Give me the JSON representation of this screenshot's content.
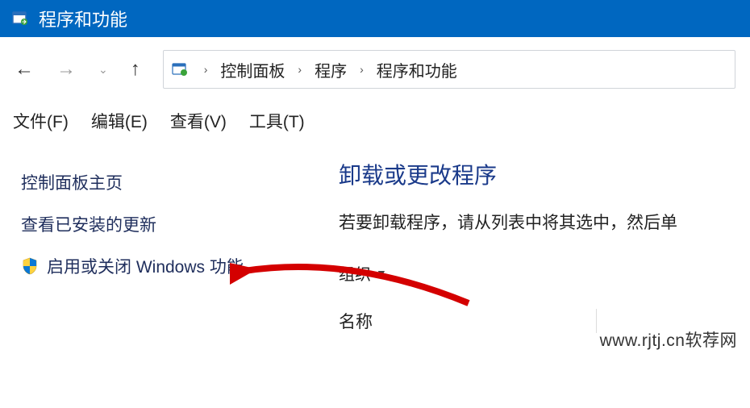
{
  "titlebar": {
    "title": "程序和功能"
  },
  "nav": {
    "back_enabled": true,
    "forward_enabled": false,
    "up_enabled": true
  },
  "breadcrumb": {
    "items": [
      "控制面板",
      "程序",
      "程序和功能"
    ]
  },
  "menubar": {
    "file": "文件(F)",
    "edit": "编辑(E)",
    "view": "查看(V)",
    "tools": "工具(T)"
  },
  "sidebar": {
    "items": [
      {
        "label": "控制面板主页"
      },
      {
        "label": "查看已安装的更新"
      },
      {
        "label": "启用或关闭 Windows 功能"
      }
    ]
  },
  "main": {
    "heading": "卸载或更改程序",
    "description": "若要卸载程序，请从列表中将其选中，然后单",
    "organize": "组织",
    "name_col": "名称"
  },
  "watermark": "www.rjtj.cn软荐网"
}
